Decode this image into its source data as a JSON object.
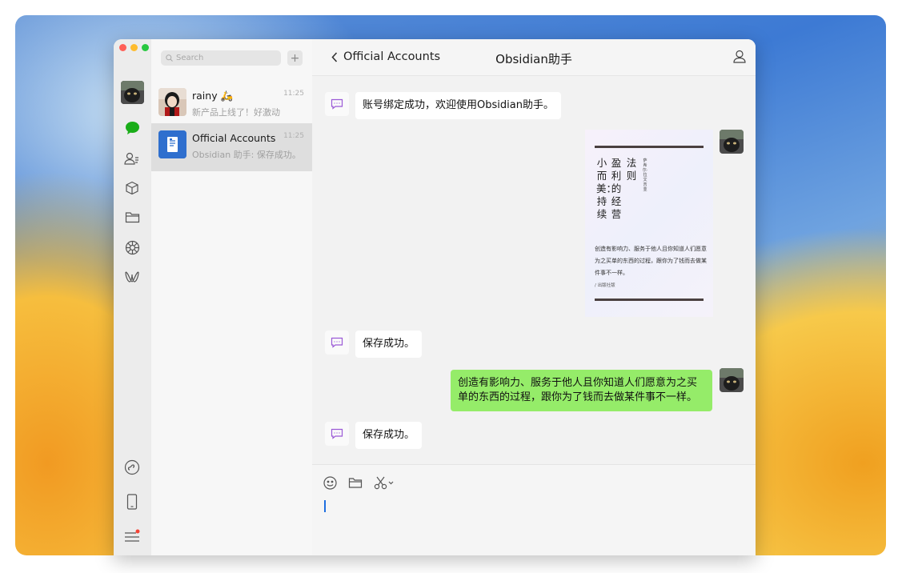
{
  "window": {
    "traffic_colors": [
      "#ff5f57",
      "#febc2e",
      "#28c840"
    ]
  },
  "sidebar": {
    "search_placeholder": "Search",
    "add_label": "+",
    "rail_icons": [
      "chat-icon",
      "contacts-icon",
      "box-icon",
      "folder-icon",
      "moments-icon",
      "channels-icon",
      "mini-program-icon",
      "phone-icon",
      "menu-icon"
    ]
  },
  "chats": [
    {
      "name": "rainy 🛵",
      "time": "11:25",
      "preview": "新产品上线了！好激动"
    },
    {
      "name": "Official Accounts",
      "time": "11:25",
      "preview": "Obsidian 助手: 保存成功。"
    }
  ],
  "header": {
    "back_label": "Official Accounts",
    "title": "Obsidian助手"
  },
  "messages": {
    "m1": "账号绑定成功，欢迎使用Obsidian助手。",
    "m3": "保存成功。",
    "m4": "创造有影响力、服务于他人且你知道人们愿意为之买单的东西的过程，跟你为了钱而去做某件事不一样。",
    "m5": "保存成功。"
  },
  "poster": {
    "col1": "小而美：持续",
    "col2": "盈利的经营",
    "col3": "法则",
    "col4": "萨希尔·拉文吉亚",
    "quote": "创造有影响力、服务于他人且你知道人们愿意为之买单的东西的过程，跟你为了钱而去做某件事不一样。",
    "source": "/ 出版社版"
  },
  "composer": {
    "tools": [
      "emoji-icon",
      "folder-icon",
      "scissors-icon"
    ],
    "accent": "#1e6fe0"
  },
  "colors": {
    "bubble_green": "#95ec69",
    "bot_icon": "#9b59d6",
    "selected_row": "#dedede"
  }
}
